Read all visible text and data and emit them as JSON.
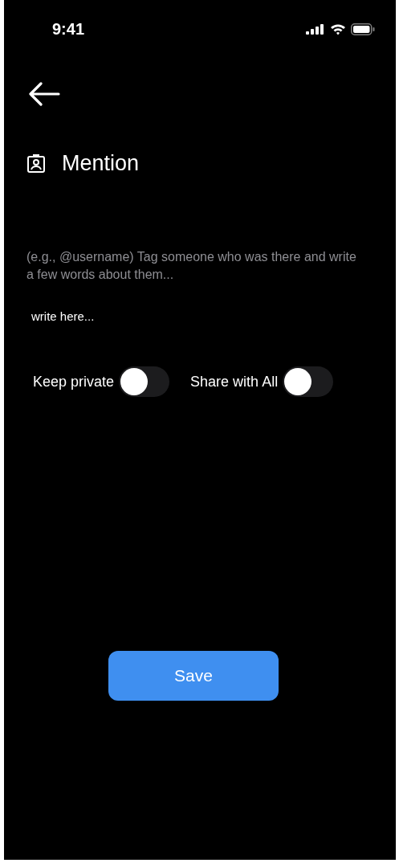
{
  "status_bar": {
    "time": "9:41"
  },
  "header": {
    "title": "Mention"
  },
  "hint": "(e.g., @username) Tag someone who was there and write a few words about them...",
  "input": {
    "placeholder": "write here..."
  },
  "toggles": [
    {
      "label": "Keep private",
      "on": false
    },
    {
      "label": "Share with All",
      "on": false
    }
  ],
  "save_button": "Save"
}
